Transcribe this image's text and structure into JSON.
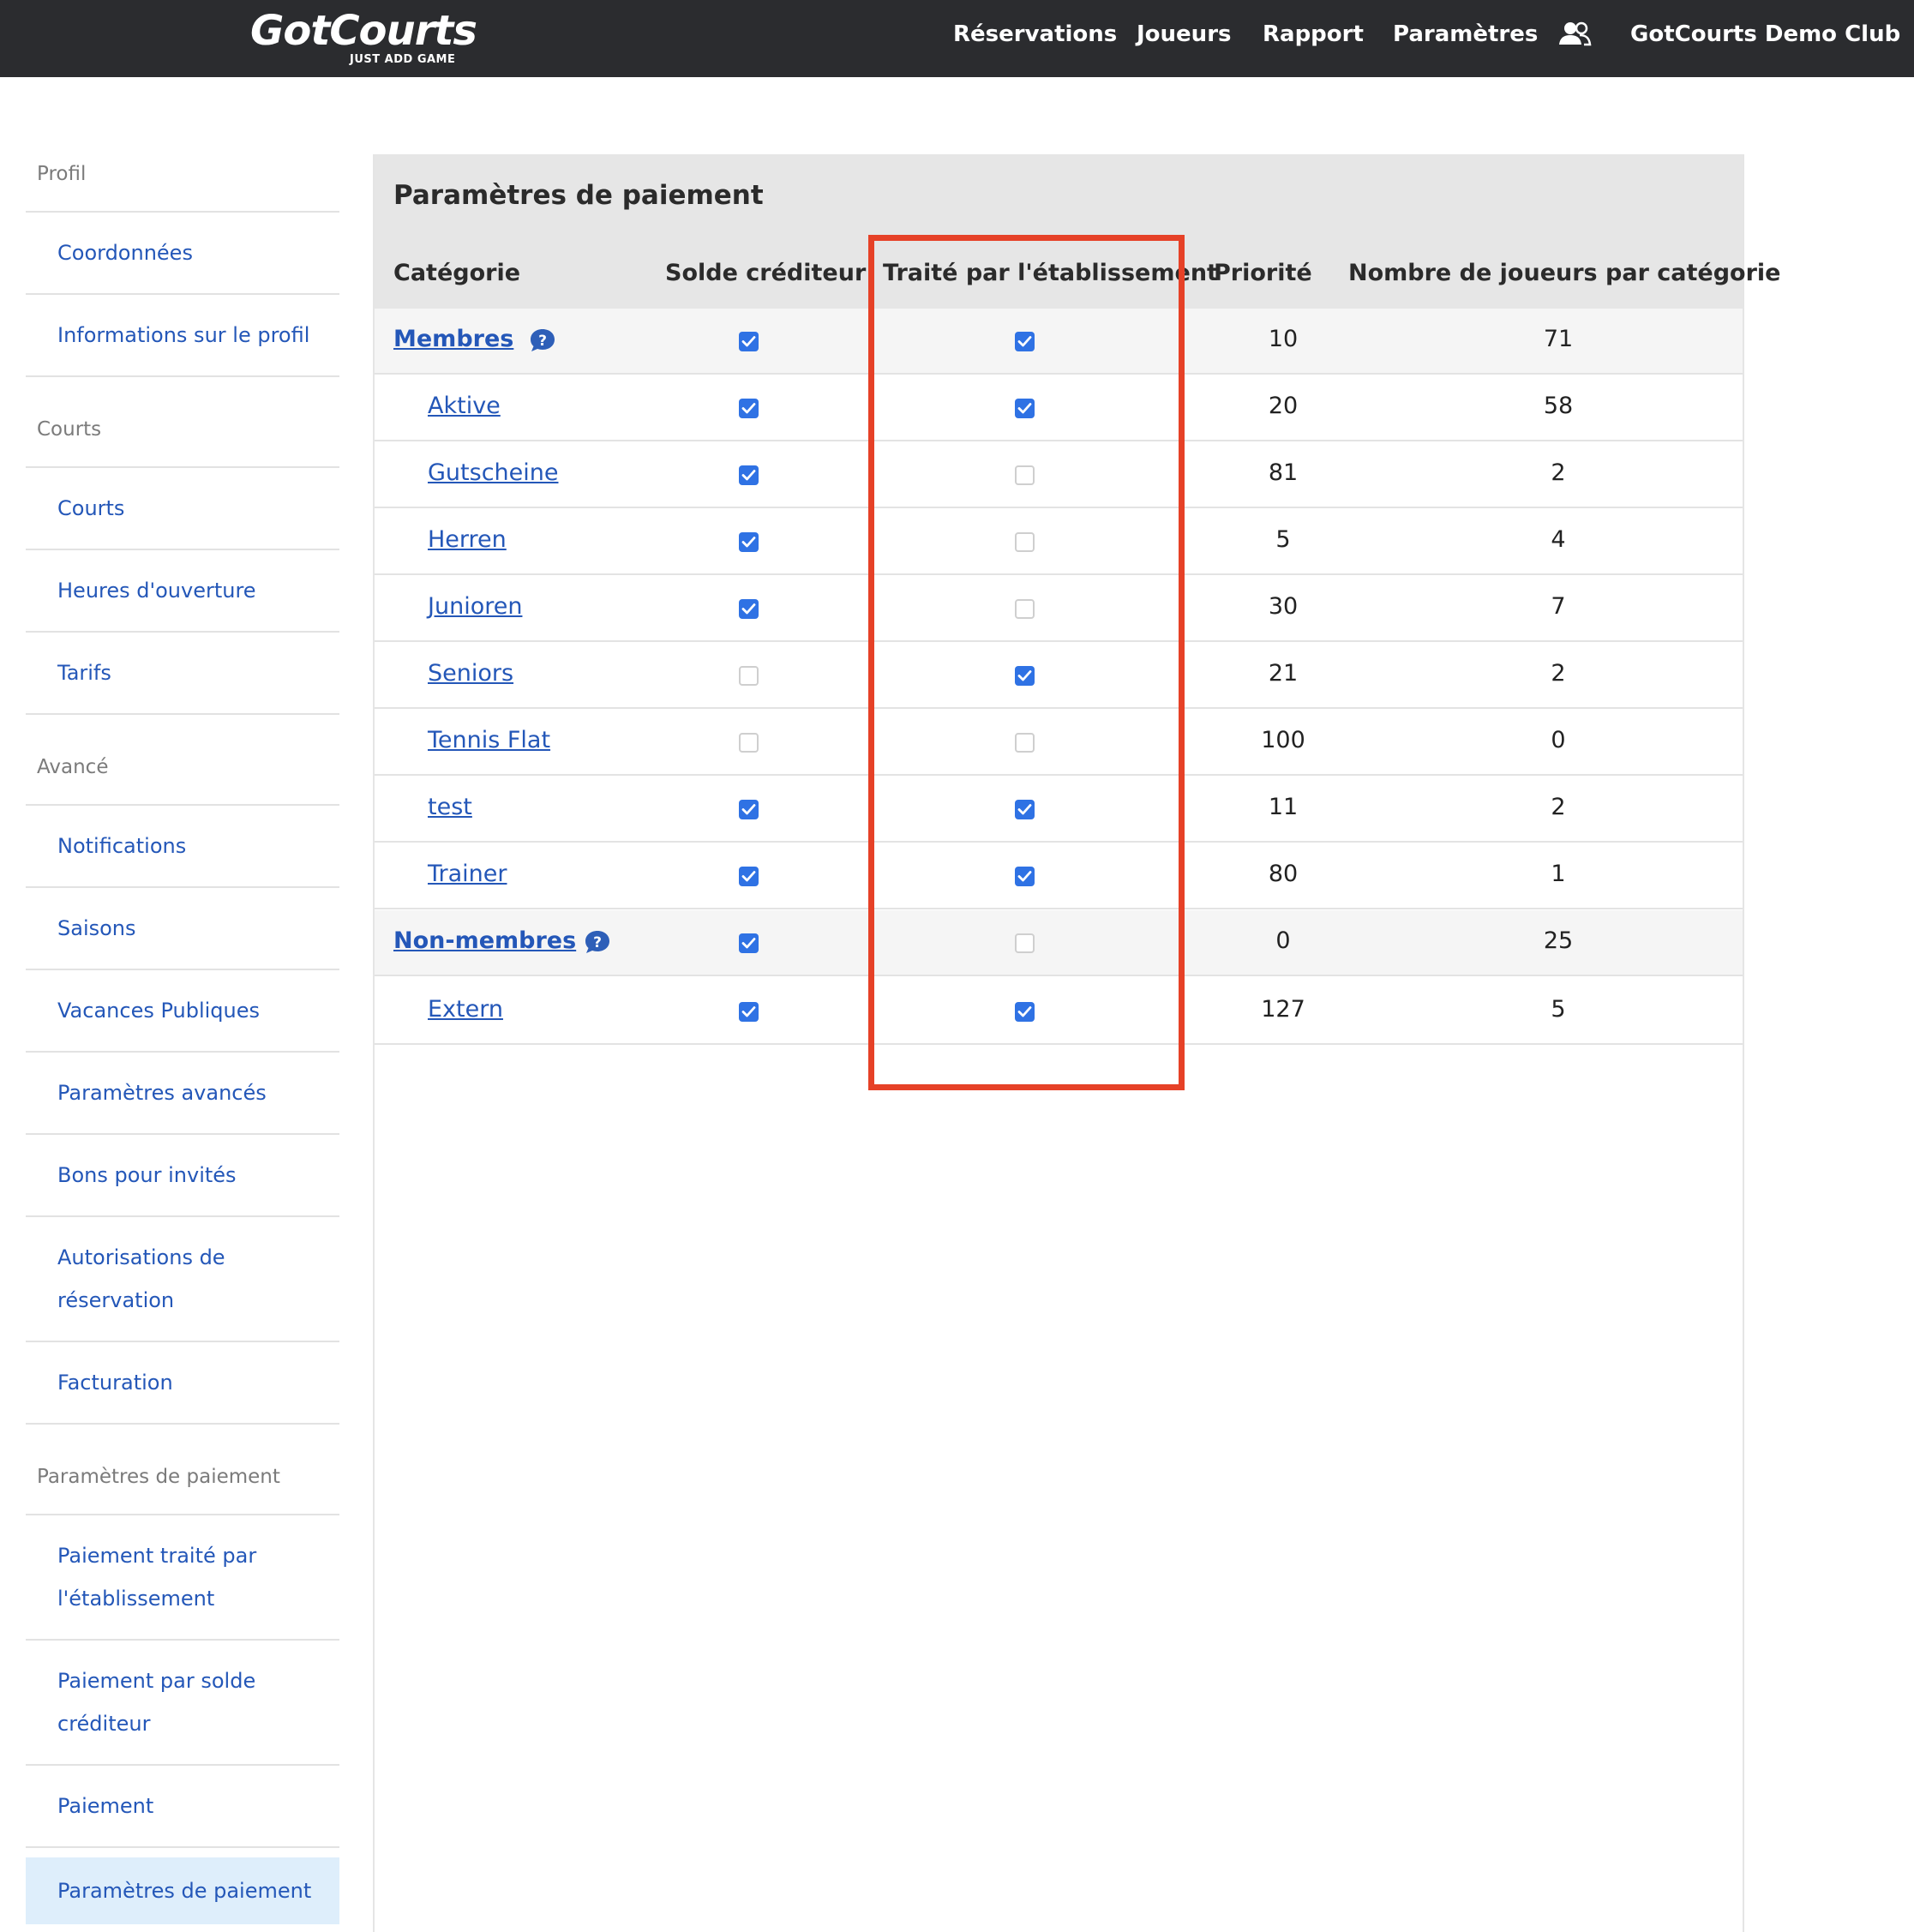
{
  "navbar": {
    "logo_text": "GotCourts",
    "logo_tagline": "JUST ADD GAME",
    "links": [
      {
        "label": "Réservations"
      },
      {
        "label": "Joueurs"
      },
      {
        "label": "Rapport"
      },
      {
        "label": "Paramètres"
      }
    ],
    "users_icon": "users-icon",
    "club_name": "GotCourts Demo Club"
  },
  "sidebar": {
    "sections": [
      {
        "title": "Profil",
        "items": [
          {
            "label": "Coordonnées"
          },
          {
            "label": "Informations sur le profil"
          }
        ]
      },
      {
        "title": "Courts",
        "items": [
          {
            "label": "Courts"
          },
          {
            "label": "Heures d'ouverture"
          },
          {
            "label": "Tarifs"
          }
        ]
      },
      {
        "title": "Avancé",
        "items": [
          {
            "label": "Notifications"
          },
          {
            "label": "Saisons"
          },
          {
            "label": "Vacances Publiques"
          },
          {
            "label": "Paramètres avancés"
          },
          {
            "label": "Bons pour invités"
          },
          {
            "label": "Autorisations de réservation"
          },
          {
            "label": "Facturation"
          }
        ]
      },
      {
        "title": "Paramètres de paiement",
        "items": [
          {
            "label": "Paiement traité par l'établissement"
          },
          {
            "label": "Paiement par solde créditeur"
          },
          {
            "label": "Paiement"
          },
          {
            "label": "Paramètres de paiement",
            "active": true
          }
        ]
      }
    ]
  },
  "main": {
    "title": "Paramètres de paiement",
    "columns": [
      "Catégorie",
      "Solde créditeur",
      "Traité par l'établissement",
      "Priorité",
      "Nombre de joueurs par catégorie"
    ],
    "rows": [
      {
        "name": "Membres",
        "parent": true,
        "help": true,
        "credit": true,
        "venue": true,
        "priority": "10",
        "players": "71"
      },
      {
        "name": "Aktive",
        "parent": false,
        "credit": true,
        "venue": true,
        "priority": "20",
        "players": "58"
      },
      {
        "name": "Gutscheine",
        "parent": false,
        "credit": true,
        "venue": false,
        "priority": "81",
        "players": "2"
      },
      {
        "name": "Herren",
        "parent": false,
        "credit": true,
        "venue": false,
        "priority": "5",
        "players": "4"
      },
      {
        "name": "Junioren",
        "parent": false,
        "credit": true,
        "venue": false,
        "priority": "30",
        "players": "7"
      },
      {
        "name": "Seniors",
        "parent": false,
        "credit": false,
        "venue": true,
        "priority": "21",
        "players": "2"
      },
      {
        "name": "Tennis Flat",
        "parent": false,
        "credit": false,
        "venue": false,
        "priority": "100",
        "players": "0"
      },
      {
        "name": "test",
        "parent": false,
        "credit": true,
        "venue": true,
        "priority": "11",
        "players": "2"
      },
      {
        "name": "Trainer",
        "parent": false,
        "credit": true,
        "venue": true,
        "priority": "80",
        "players": "1"
      },
      {
        "name": "Non-membres",
        "parent": true,
        "help": true,
        "credit": true,
        "venue": false,
        "priority": "0",
        "players": "25"
      },
      {
        "name": "Extern",
        "parent": false,
        "credit": true,
        "venue": true,
        "priority": "127",
        "players": "5"
      }
    ]
  },
  "colors": {
    "navbar_bg": "#2b2c2f",
    "link_blue": "#2457b8",
    "checkbox_blue": "#2f72e4",
    "highlight_red": "#e64127",
    "header_gray": "#e6e6e6",
    "active_item_bg": "#deeefb"
  }
}
